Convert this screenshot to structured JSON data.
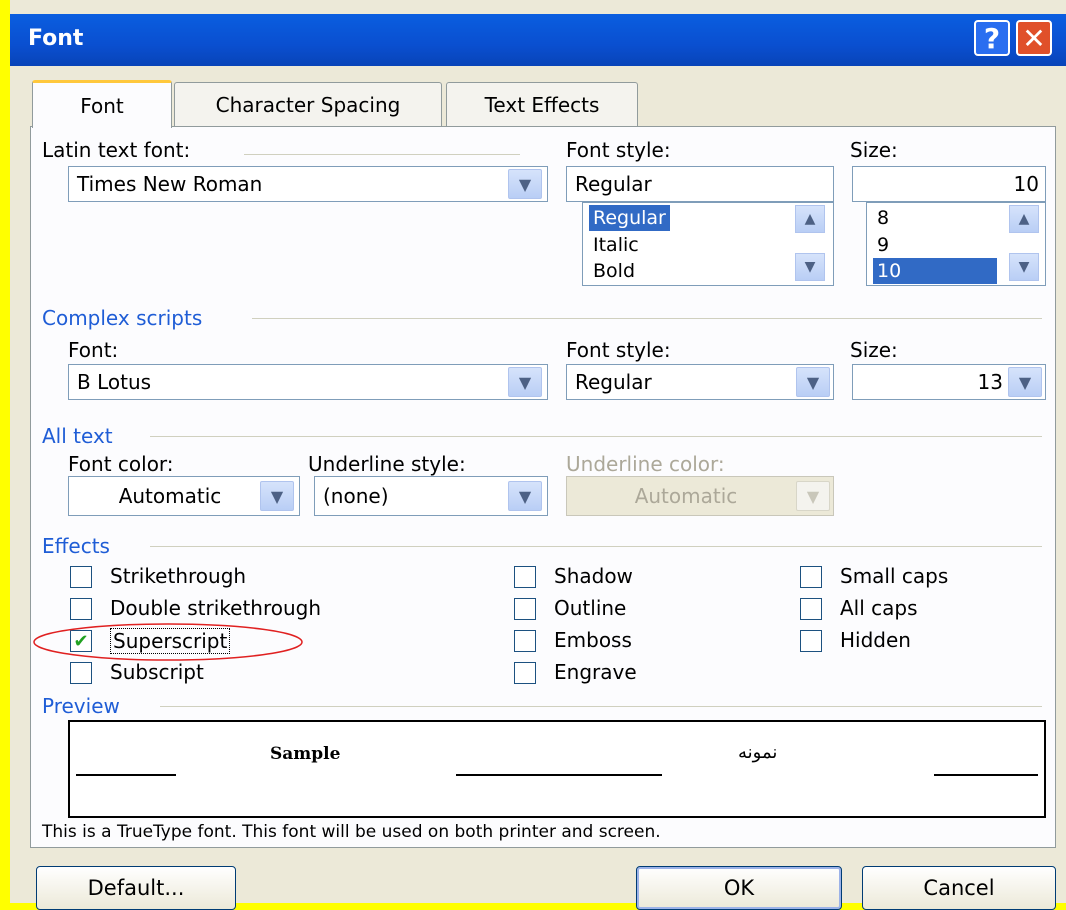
{
  "window": {
    "title": "Font",
    "help_glyph": "?",
    "close_glyph": "✕"
  },
  "tabs": [
    "Font",
    "Character Spacing",
    "Text Effects"
  ],
  "latin": {
    "font_label": "Latin text font:",
    "font_value": "Times New Roman",
    "style_label": "Font style:",
    "style_value": "Regular",
    "style_options": [
      "Regular",
      "Italic",
      "Bold"
    ],
    "style_selected": "Regular",
    "size_label": "Size:",
    "size_value": "10",
    "size_options": [
      "8",
      "9",
      "10"
    ],
    "size_selected": "10"
  },
  "complex": {
    "group_label": "Complex scripts",
    "font_label": "Font:",
    "font_value": "B Lotus",
    "style_label": "Font style:",
    "style_value": "Regular",
    "size_label": "Size:",
    "size_value": "13"
  },
  "all_text": {
    "group_label": "All text",
    "font_color_label": "Font color:",
    "font_color_value": "Automatic",
    "underline_style_label": "Underline style:",
    "underline_style_value": "(none)",
    "underline_color_label": "Underline color:",
    "underline_color_value": "Automatic"
  },
  "effects": {
    "group_label": "Effects",
    "items": [
      {
        "label": "Strikethrough",
        "checked": false
      },
      {
        "label": "Double strikethrough",
        "checked": false
      },
      {
        "label": "Superscript",
        "checked": true
      },
      {
        "label": "Subscript",
        "checked": false
      },
      {
        "label": "Shadow",
        "checked": false
      },
      {
        "label": "Outline",
        "checked": false
      },
      {
        "label": "Emboss",
        "checked": false
      },
      {
        "label": "Engrave",
        "checked": false
      },
      {
        "label": "Small caps",
        "checked": false
      },
      {
        "label": "All caps",
        "checked": false
      },
      {
        "label": "Hidden",
        "checked": false
      }
    ]
  },
  "preview": {
    "group_label": "Preview",
    "sample_latin": "Sample",
    "sample_complex": "نمونه"
  },
  "info_text": "This is a TrueType font. This font will be used on both printer and screen.",
  "buttons": {
    "default": "Default...",
    "ok": "OK",
    "cancel": "Cancel"
  },
  "colors": {
    "group_label": "#1f5dd6",
    "selection": "#316ac5",
    "dialog_bg": "#ece9d8",
    "slide_bg": "#ffff00",
    "annotation": "#e02020"
  }
}
